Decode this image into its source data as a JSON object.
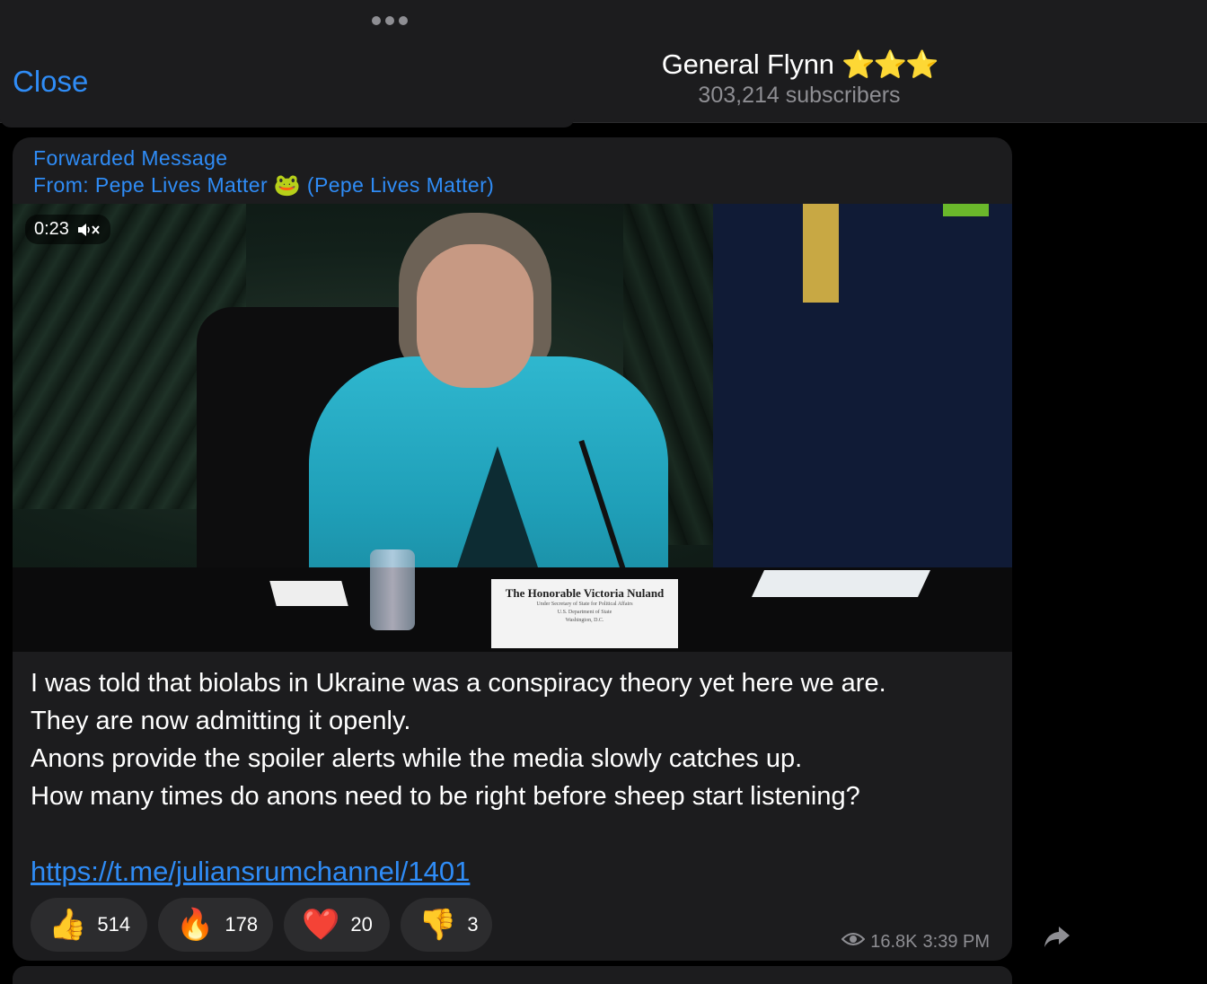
{
  "header": {
    "close_label": "Close",
    "channel_title": "General Flynn",
    "title_badges": "⭐⭐⭐",
    "subscribers": "303,214 subscribers"
  },
  "message": {
    "forwarded_label": "Forwarded Message",
    "from_prefix": "From:",
    "from_name": "Pepe Lives Matter",
    "from_emoji": "🐸",
    "from_handle": "(Pepe Lives Matter)",
    "video": {
      "duration": "0:23",
      "muted_icon": "speaker-muted-icon",
      "nameplate_name": "The Honorable Victoria Nuland",
      "nameplate_sub1": "Under Secretary of State for Political Affairs",
      "nameplate_sub2": "U.S. Department of State",
      "nameplate_sub3": "Washington, D.C."
    },
    "text_lines": [
      "I was told that biolabs in Ukraine was a conspiracy theory yet here we are.",
      "They are now admitting it openly.",
      "Anons provide the spoiler alerts while the media slowly catches up.",
      "How many times do anons need to be right before sheep start listening?"
    ],
    "link": "https://t.me/juliansrumchannel/1401",
    "reactions": [
      {
        "emoji": "👍",
        "count": "514"
      },
      {
        "emoji": "🔥",
        "count": "178"
      },
      {
        "emoji": "❤️",
        "count": "20"
      },
      {
        "emoji": "👎",
        "count": "3"
      }
    ],
    "views": "16.8K",
    "time": "3:39 PM"
  },
  "colors": {
    "accent": "#2f8cf6",
    "bubble": "#1c1c1e",
    "background": "#000000"
  }
}
